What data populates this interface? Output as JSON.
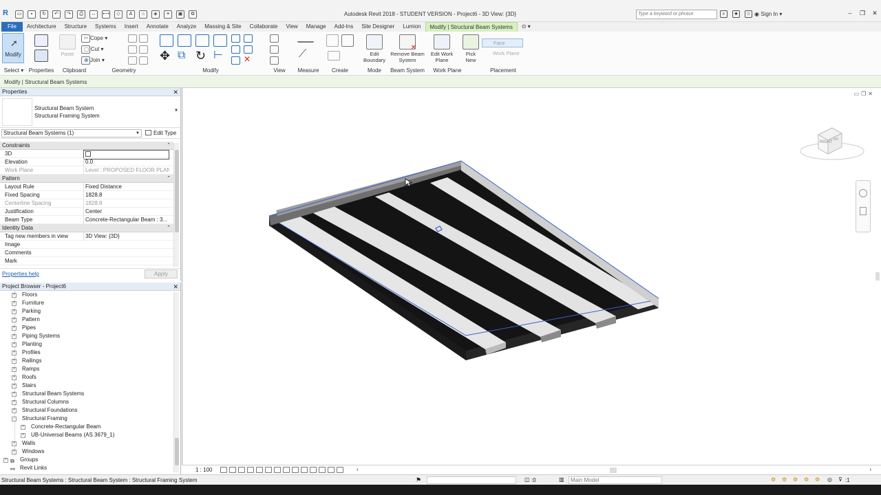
{
  "app": {
    "title": "Autodesk Revit 2018 - STUDENT VERSION -    Project6 - 3D View: {3D}",
    "search_placeholder": "Type a keyword or phrase",
    "sign_in": "Sign In",
    "logo": "R"
  },
  "ribbon_tabs": [
    "File",
    "Architecture",
    "Structure",
    "Systems",
    "Insert",
    "Annotate",
    "Analyze",
    "Massing & Site",
    "Collaborate",
    "View",
    "Manage",
    "Add-Ins",
    "Site Designer",
    "Lumion",
    "Modify | Structural Beam Systems"
  ],
  "ribbon": {
    "modify": "Modify",
    "select": "Select",
    "properties": "Properties",
    "clipboard": "Clipboard",
    "paste": "Paste",
    "geometry": "Geometry",
    "cope": "Cope",
    "cut": "Cut",
    "join": "Join",
    "modify_group": "Modify",
    "view": "View",
    "measure": "Measure",
    "create": "Create",
    "edit_boundary": "Edit Boundary",
    "mode": "Mode",
    "remove_beam_system": "Remove Beam System",
    "beam_system": "Beam System",
    "edit_work_plane": "Edit Work Plane",
    "work_plane": "Work Plane",
    "pick_new": "Pick New",
    "face": "Face",
    "work_plane_btn": "Work Plane",
    "placement": "Placement"
  },
  "options_bar": "Modify | Structural Beam Systems",
  "properties": {
    "header": "Properties",
    "type_line1": "Structural Beam System",
    "type_line2": "Structural Framing System",
    "selector": "Structural Beam Systems (1)",
    "edit_type": "Edit Type",
    "help": "Properties help",
    "apply": "Apply",
    "rows": [
      {
        "kind": "cat",
        "label": "Constraints"
      },
      {
        "kind": "row",
        "key": "3D",
        "value": "",
        "checkbox": true
      },
      {
        "kind": "row",
        "key": "Elevation",
        "value": "0.0"
      },
      {
        "kind": "grey",
        "key": "Work Plane",
        "value": "Level : PROPOSED FLOOR PLAN"
      },
      {
        "kind": "cat",
        "label": "Pattern"
      },
      {
        "kind": "row",
        "key": "Layout Rule",
        "value": "Fixed Distance"
      },
      {
        "kind": "row",
        "key": "Fixed Spacing",
        "value": "1828.8"
      },
      {
        "kind": "grey",
        "key": "Centerline Spacing",
        "value": "1828.8"
      },
      {
        "kind": "row",
        "key": "Justification",
        "value": "Center"
      },
      {
        "kind": "row",
        "key": "Beam Type",
        "value": "Concrete-Rectangular Beam : 3..."
      },
      {
        "kind": "cat",
        "label": "Identity Data"
      },
      {
        "kind": "row",
        "key": "Tag new members in view",
        "value": "3D View: {3D}"
      },
      {
        "kind": "row",
        "key": "Image",
        "value": ""
      },
      {
        "kind": "row",
        "key": "Comments",
        "value": ""
      },
      {
        "kind": "row",
        "key": "Mark",
        "value": ""
      }
    ]
  },
  "browser": {
    "header": "Project Browser - Project6",
    "items": [
      {
        "label": "Floors",
        "level": 1,
        "exp": "+"
      },
      {
        "label": "Furniture",
        "level": 1,
        "exp": "+"
      },
      {
        "label": "Parking",
        "level": 1,
        "exp": "+"
      },
      {
        "label": "Pattern",
        "level": 1,
        "exp": "+"
      },
      {
        "label": "Pipes",
        "level": 1,
        "exp": "+"
      },
      {
        "label": "Piping Systems",
        "level": 1,
        "exp": "+"
      },
      {
        "label": "Planting",
        "level": 1,
        "exp": "+"
      },
      {
        "label": "Profiles",
        "level": 1,
        "exp": "+"
      },
      {
        "label": "Railings",
        "level": 1,
        "exp": "+"
      },
      {
        "label": "Ramps",
        "level": 1,
        "exp": "+"
      },
      {
        "label": "Roofs",
        "level": 1,
        "exp": "+"
      },
      {
        "label": "Stairs",
        "level": 1,
        "exp": "+"
      },
      {
        "label": "Structural Beam Systems",
        "level": 1,
        "exp": "+"
      },
      {
        "label": "Structural Columns",
        "level": 1,
        "exp": "+"
      },
      {
        "label": "Structural Foundations",
        "level": 1,
        "exp": "+"
      },
      {
        "label": "Structural Framing",
        "level": 1,
        "exp": "-"
      },
      {
        "label": "Concrete-Rectangular Beam",
        "level": 2,
        "exp": "+"
      },
      {
        "label": "UB-Universal Beams (AS 3679_1)",
        "level": 2,
        "exp": "+"
      },
      {
        "label": "Walls",
        "level": 1,
        "exp": "+"
      },
      {
        "label": "Windows",
        "level": 1,
        "exp": "+"
      },
      {
        "label": "Groups",
        "level": 0,
        "exp": "+"
      },
      {
        "label": "Revit Links",
        "level": 0,
        "exp": ""
      }
    ]
  },
  "viewport": {
    "viewcube_right": "RIGHT",
    "viewcube_back": "BA",
    "scale": "1 : 100"
  },
  "status": {
    "text": "Structural Beam Systems : Structural Beam System : Structural Framing System",
    "count": ":0",
    "model": "Main Model",
    "filter_count": ":1"
  },
  "colors": {
    "file_tab": "#2a6ebc",
    "context_tab": "#d6f0c2",
    "selection_edge": "#3a5fcd"
  }
}
